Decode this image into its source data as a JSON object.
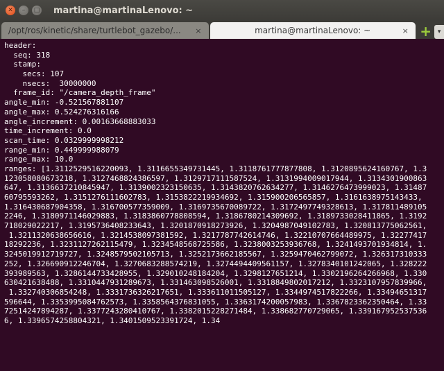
{
  "window": {
    "title": "martina@martinaLenovo: ~",
    "close_glyph": "✕",
    "min_glyph": "–",
    "max_glyph": "□"
  },
  "tabs": [
    {
      "label": "/opt/ros/kinetic/share/turtlebot_gazebo/...",
      "close": "×",
      "active": false
    },
    {
      "label": "martina@martinaLenovo: ~",
      "close": "×",
      "active": true
    }
  ],
  "tabbar": {
    "add_icon": "+",
    "menu_icon": "▾"
  },
  "terminal": {
    "lines": [
      "header:",
      "  seq: 318",
      "  stamp:",
      "    secs: 107",
      "    nsecs:  30000000",
      "  frame_id: \"/camera_depth_frame\"",
      "angle_min: -0.521567881107",
      "angle_max: 0.524276316166",
      "angle_increment: 0.00163668883033",
      "time_increment: 0.0",
      "scan_time: 0.0329999998212",
      "range_min: 0.449999988079",
      "range_max: 10.0",
      "ranges: [1.3112529516220093, 1.3116655349731445, 1.3118761777877808, 1.3120895624160767, 1.3123058080673218, 1.3127468824386597, 1.3129717111587524, 1.3131994009017944, 1.3134301900863647, 1.3136637210845947, 1.3139002323150635, 1.3143820762634277, 1.3146276473999023, 1.3148760795593262, 1.3151276111602783, 1.3153822219934692, 1.315900206565857, 1.3161638975143433, 1.316430687904358, 1.316700577359009, 1.3169735670089722, 1.3172497749328613, 1.3178114891052246, 1.3180971146029883, 1.3183860778808594, 1.3186780214309692, 1.3189733028411865, 1.3192718029022217, 1.3195736408233643, 1.3201870918273926, 1.3204987049102783, 1.320813775062561, 1.3211320638656616, 1.3214538097381592, 1.3217787742614746, 1.32210707664489975, 1.3227741718292236, 1.3231127262115479, 1.3234548568725586, 1.3238003253936768, 1.3241493701934814, 1.3245019912719727, 1.3248579502105713, 1.3252173662185567, 1.3259470462799072, 1.326317310333252, 1.326690912246704, 1.3270683288574219, 1.3274494409561157, 1.3278340101242065, 1.328222393989563, 1.3286144733428955, 1.329010248184204, 1.3298127651214, 1.3302196264266968, 1.330630421638488, 1.3310447931289673, 1.331463098526001, 1.3318849802017212, 1.3323107957839966, 1.332740306854248, 1.3331736326217651, 1.333611011505127, 1.3344974517822266, 1.33494651317596644, 1.3353995084762573, 1.3358564376831055, 1.3363174200057983, 1.3367823362350464, 1.3372514247894287, 1.3377243280410767, 1.3382015228271484, 1.338682770729065, 1.3391679525375366, 1.3396574258804321, 1.3401509523391724, 1.34"
    ],
    "wrap_columns": 92
  }
}
